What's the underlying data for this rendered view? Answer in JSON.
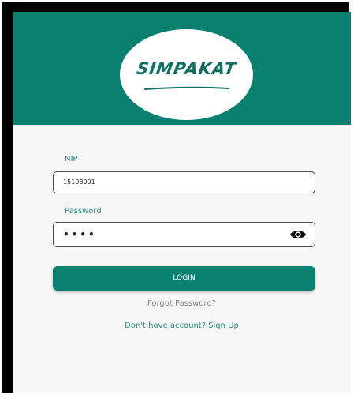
{
  "header": {
    "logo_text": "SIMPAKAT",
    "background_color": "#0a8070"
  },
  "form": {
    "nip_label": "NIP",
    "nip_value": "15108001",
    "password_label": "Password",
    "password_value": "••••",
    "login_label": "LOGIN"
  },
  "links": {
    "forgot_password": "Forgot Password?",
    "sign_up": "Don't have account? Sign Up"
  },
  "icons": {
    "password_toggle": "eye-icon"
  }
}
